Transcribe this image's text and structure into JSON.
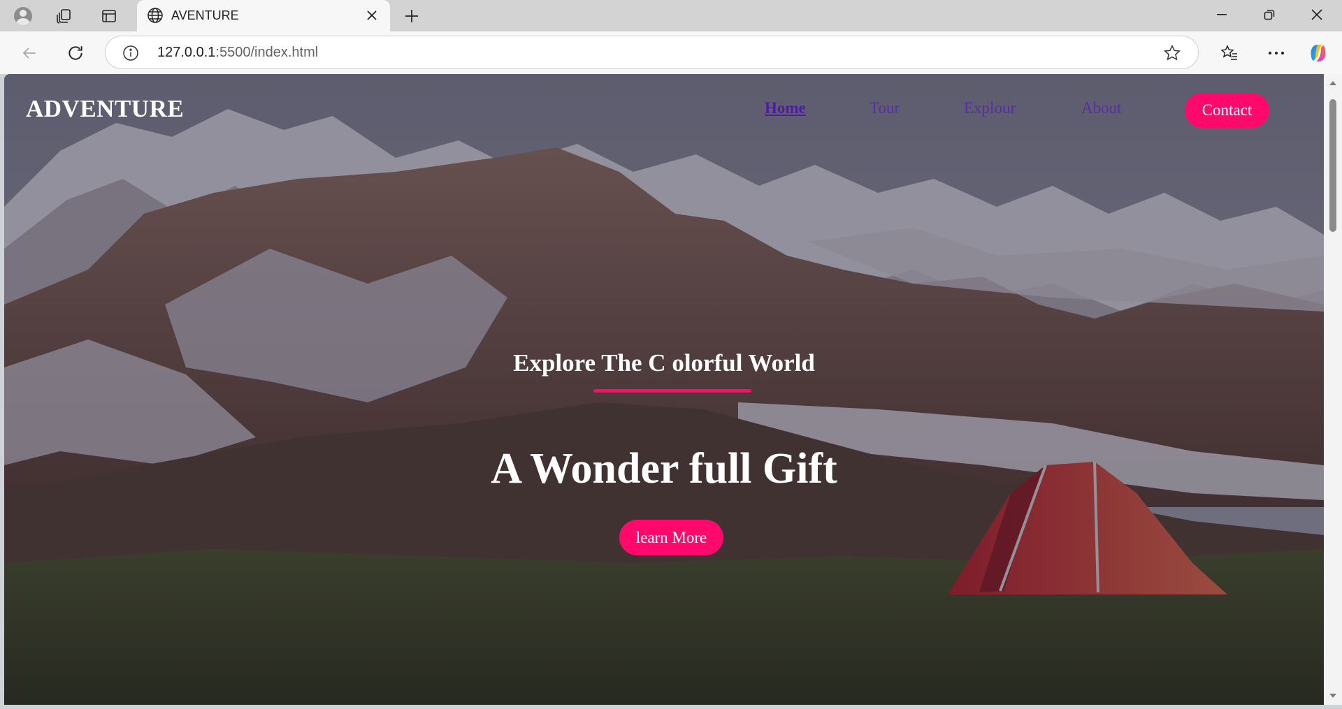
{
  "browser": {
    "tab_title": "AVENTURE",
    "url_host": "127.0.0.1",
    "url_rest": ":5500/index.html"
  },
  "site": {
    "logo": "ADVENTURE",
    "nav": {
      "home": "Home",
      "tour": "Tour",
      "explour": "Explour",
      "about": "About",
      "contact": "Contact"
    },
    "hero": {
      "subtitle": "Explore The C olorful World",
      "headline": "A Wonder full Gift",
      "cta": "learn More"
    }
  },
  "colors": {
    "accent": "#ff0a6c",
    "nav_link": "#5a2ba8"
  },
  "icons": [
    "profile-icon",
    "workspaces-icon",
    "tab-actions-icon",
    "globe-icon",
    "close-icon",
    "plus-icon",
    "minimize-icon",
    "restore-icon",
    "window-close-icon",
    "back-arrow-icon",
    "reload-icon",
    "info-icon",
    "star-icon",
    "favorites-icon",
    "more-icon",
    "copilot-icon"
  ]
}
